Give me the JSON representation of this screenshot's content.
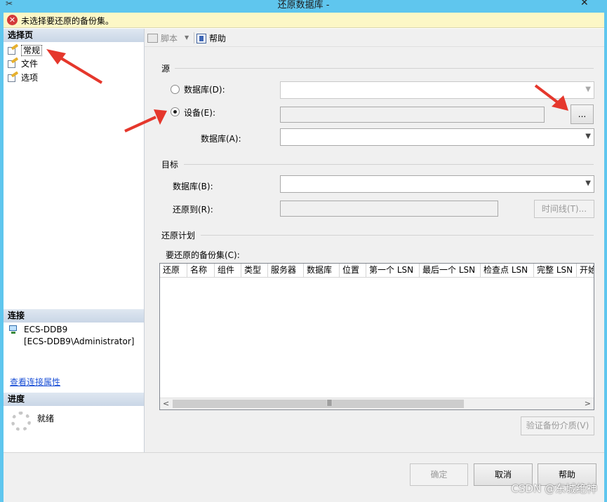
{
  "window": {
    "title": "还原数据库 -",
    "close_glyph": "✕"
  },
  "error_banner": {
    "message": "未选择要还原的备份集。"
  },
  "left_pane": {
    "select_page_header": "选择页",
    "pages": [
      {
        "label": "常规"
      },
      {
        "label": "文件"
      },
      {
        "label": "选项"
      }
    ],
    "connection_header": "连接",
    "server_name": "ECS-DDB9",
    "server_user": "[ECS-DDB9\\Administrator]",
    "view_connection_link": "查看连接属性",
    "progress_header": "进度",
    "progress_status": "就绪"
  },
  "toolbar": {
    "script_label": "脚本",
    "help_label": "帮助"
  },
  "source": {
    "group_label": "源",
    "database_radio_label": "数据库(D):",
    "device_radio_label": "设备(E):",
    "browse_button_label": "...",
    "device_database_label": "数据库(A):",
    "device_value": "",
    "database_value": "",
    "device_database_value": ""
  },
  "target": {
    "group_label": "目标",
    "database_label": "数据库(B):",
    "restore_to_label": "还原到(R):",
    "timeline_button_label": "时间线(T)...",
    "database_value": "",
    "restore_to_value": ""
  },
  "restore_plan": {
    "group_label": "还原计划",
    "backup_sets_label": "要还原的备份集(C):",
    "columns": [
      "还原",
      "名称",
      "组件",
      "类型",
      "服务器",
      "数据库",
      "位置",
      "第一个 LSN",
      "最后一个 LSN",
      "检查点 LSN",
      "完整 LSN",
      "开始"
    ],
    "verify_button_label": "验证备份介质(V)"
  },
  "buttons": {
    "ok": "确定",
    "cancel": "取消",
    "help": "帮助"
  },
  "watermark": "CSDN @东城绝神",
  "colors": {
    "title_bar": "#5fc6ee",
    "error_banner_bg": "#fcf7c6",
    "error_icon": "#d33a3a",
    "link": "#1a4fd6",
    "annotation_arrow": "#e5372c"
  }
}
